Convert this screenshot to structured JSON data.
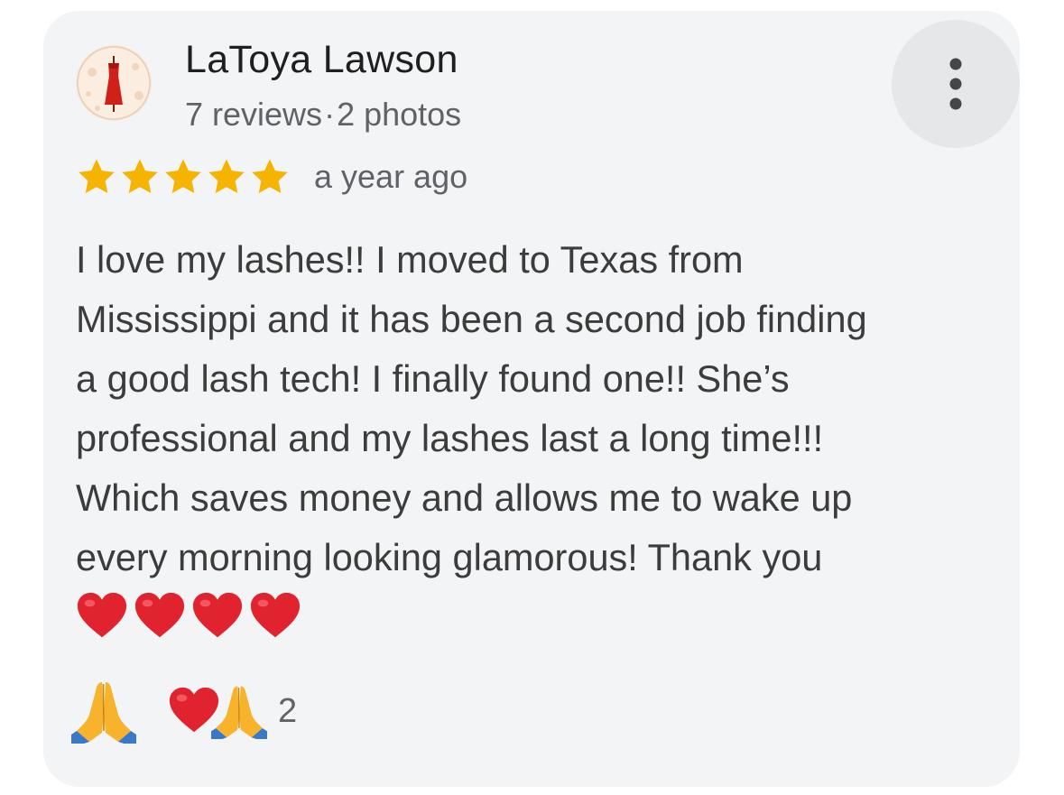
{
  "review": {
    "author": {
      "name": "LaToya Lawson",
      "reviews_count": "7 reviews",
      "separator": "·",
      "photos_count": "2 photos"
    },
    "rating": 5,
    "max_rating": 5,
    "time": "a year ago",
    "text": "I love my lashes!! I moved to Texas from\nMississippi and it has been a second job finding\na good lash tech! I finally found one!! She’s\nprofessional and my lashes last a long time!!!\nWhich saves money and allows me to wake up\nevery morning looking glamorous! Thank you",
    "emoji_line": [
      "heart-emoji",
      "heart-emoji",
      "heart-emoji",
      "heart-emoji"
    ],
    "reactions": {
      "count": "2",
      "icons": [
        "heart-emoji",
        "folded-hands-emoji"
      ]
    }
  },
  "colors": {
    "card_background": "#f3f4f6",
    "star": "#f4b400",
    "heart": "#e0232e",
    "text_primary": "#1f1f1f",
    "text_secondary": "#5f6368"
  },
  "icons": {
    "more_menu": "more-vertical-icon",
    "react_button": "folded-hands-icon"
  }
}
